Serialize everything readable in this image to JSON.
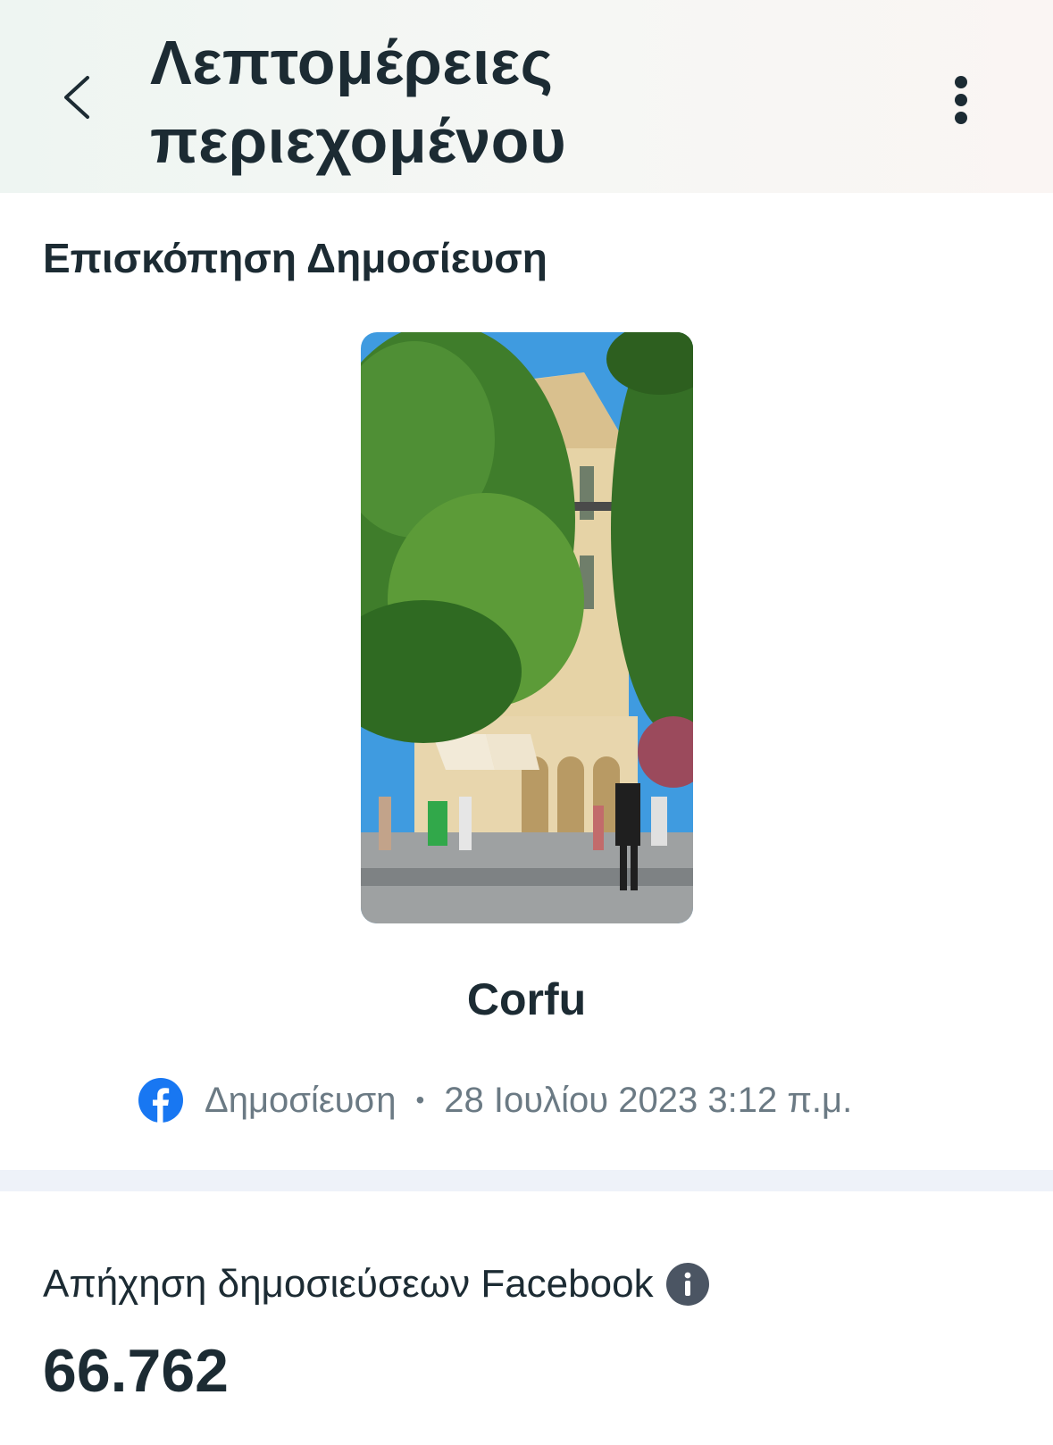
{
  "header": {
    "title_line1": "Λεπτομέρειες",
    "title_line2": "περιεχομένου",
    "back_icon": "chevron-left-icon",
    "more_icon": "more-vertical-icon"
  },
  "preview": {
    "heading": "Επισκόπηση Δημοσίευση",
    "post_title": "Corfu",
    "platform_icon": "facebook-icon",
    "post_type": "Δημοσίευση",
    "separator": "•",
    "timestamp": "28 Ιουλίου 2023 3:12 π.μ."
  },
  "metrics": {
    "reach_label": "Απήχηση δημοσιεύσεων Facebook",
    "info_icon": "info-icon",
    "reach_value": "66.762"
  },
  "colors": {
    "text_primary": "#1c2b33",
    "text_secondary": "#6b7a84",
    "facebook_blue": "#1877f2",
    "info_icon_bg": "#4b5563",
    "divider": "#eef2f9"
  }
}
